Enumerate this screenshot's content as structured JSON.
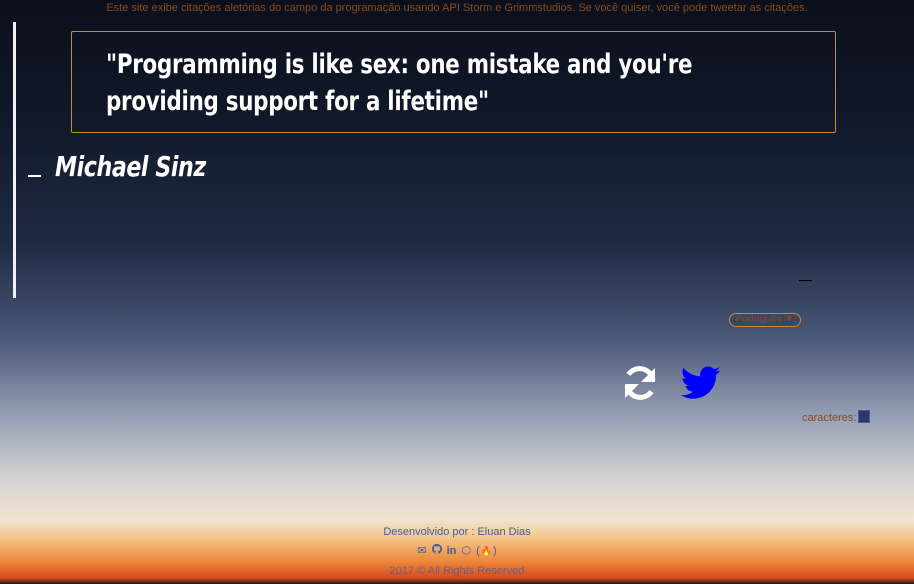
{
  "intro_text": "Este site exibe citações aletórias do campo da programação usando API Storm e Grimmstudios. Se você quiser, você pode tweetar as citações.",
  "quote": {
    "text": "\"Programming is like sex: one mistake and you're providing support for a lifetime\"",
    "author": "Michael Sinz"
  },
  "language": {
    "selected": "Português ▼"
  },
  "characters_label": "caracteres:",
  "footer": {
    "developed_by": "Desenvolvido por : Eluan Dias",
    "copyright": "2017 © All Rights Reserved"
  },
  "icons": {
    "refresh": "refresh-icon",
    "twitter": "twitter-icon",
    "email": "envelope-icon",
    "github": "github-icon",
    "linkedin": "linkedin-icon",
    "codepen": "codepen-icon",
    "fcc": "fire-icon"
  },
  "colors": {
    "accent": "#c98a2f",
    "twitter": "#0000ff",
    "footer_text": "#3a5fa5"
  }
}
